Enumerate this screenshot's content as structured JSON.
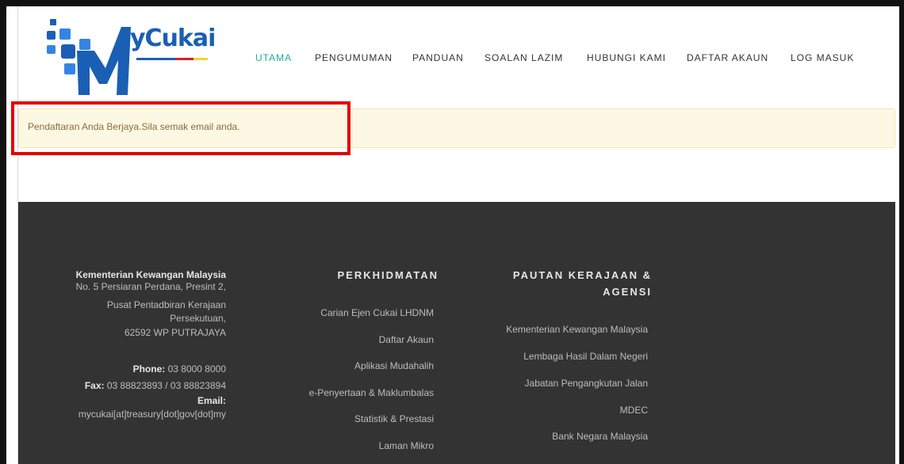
{
  "header": {
    "logo_text": "yCukai",
    "nav": [
      "UTAMA",
      "PENGUMUMAN",
      "PANDUAN",
      "SOALAN LAZIM",
      "HUBUNGI KAMI",
      "DAFTAR AKAUN",
      "LOG MASUK"
    ]
  },
  "alert": {
    "message": "Pendaftaran Anda Berjaya.Sila semak email anda."
  },
  "footer": {
    "org_name": "Kementerian Kewangan Malaysia",
    "address": [
      "No. 5 Persiaran Perdana, Presint 2,",
      "Pusat Pentadbiran Kerajaan",
      "Persekutuan,",
      "62592 WP PUTRAJAYA"
    ],
    "phone_label": "Phone:",
    "phone": "03 8000 8000",
    "fax_label": "Fax:",
    "fax": "03 88823893 / 03 88823894",
    "email_label": "Email:",
    "email": "mycukai[at]treasury[dot]gov[dot]my",
    "services_title": "PERKHIDMATAN",
    "services": [
      "Carian Ejen Cukai LHDNM",
      "Daftar Akaun",
      "Aplikasi Mudahalih",
      "e-Penyertaan & Maklumbalas",
      "Statistik & Prestasi",
      "Laman Mikro"
    ],
    "links_title_1": "PAUTAN KERAJAAN &",
    "links_title_2": "AGENSI",
    "links": [
      "Kementerian Kewangan Malaysia",
      "Lembaga Hasil Dalam Negeri",
      "Jabatan Pengangkutan Jalan",
      "MDEC",
      "Bank Negara Malaysia"
    ]
  },
  "colors": {
    "nav_active": "#2aa39a",
    "alert_bg": "#fcf8e3",
    "alert_text": "#8a6d3b",
    "highlight_border": "#e60000",
    "footer_bg": "#333333",
    "logo_blue": "#1a5fb4"
  }
}
